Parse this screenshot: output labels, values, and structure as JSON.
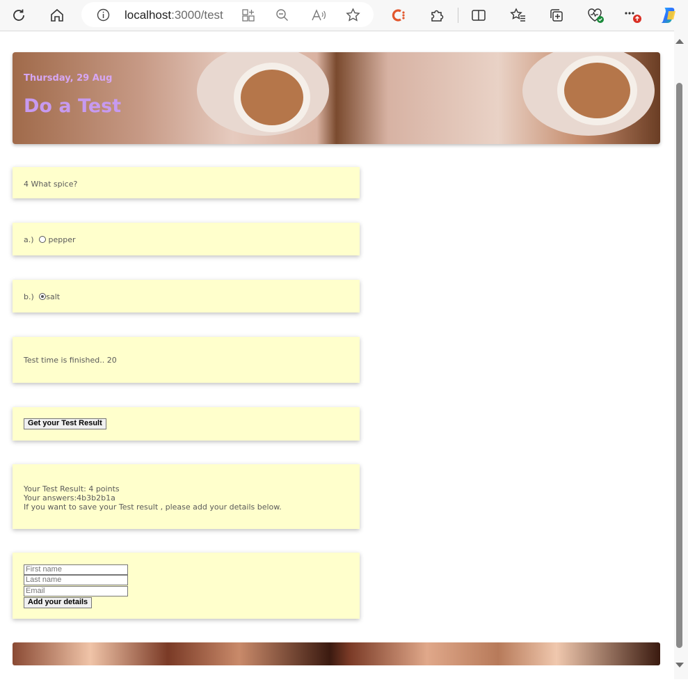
{
  "browser": {
    "url_host": "localhost",
    "url_rest": ":3000/test"
  },
  "hero": {
    "date": "Thursday, 29 Aug",
    "title": "Do a Test"
  },
  "question": {
    "text": "4 What spice?"
  },
  "options": [
    {
      "prefix": "a.)",
      "label": "pepper",
      "selected": false
    },
    {
      "prefix": "b.)",
      "label": "salt",
      "selected": true
    }
  ],
  "timer": {
    "text": "Test time is finished.. 20"
  },
  "result_button": {
    "label": "Get your Test Result"
  },
  "result": {
    "line1": "Your Test Result: 4 points",
    "line2": "Your answers:4b3b2b1a",
    "line3": "If you want to save your Test result , please add your details below."
  },
  "form": {
    "first_name_placeholder": "First name",
    "last_name_placeholder": "Last name",
    "email_placeholder": "Email",
    "submit_label": "Add your details"
  },
  "icons": {
    "refresh": "refresh-icon",
    "home": "home-icon",
    "info": "info-icon",
    "apps": "add-app-icon",
    "zoom": "zoom-out-icon",
    "read_aloud": "read-aloud-icon",
    "favorite": "star-icon",
    "extensions": "puzzle-icon",
    "split": "split-screen-icon",
    "favorites": "favorites-icon",
    "collections": "collections-icon",
    "health": "browser-essentials-icon",
    "more": "more-icon",
    "copilot": "copilot-icon"
  },
  "colors": {
    "card_bg": "#ffffcc",
    "title_color": "#c79af0",
    "badge_red": "#d93025",
    "badge_green": "#1a8a3a"
  }
}
